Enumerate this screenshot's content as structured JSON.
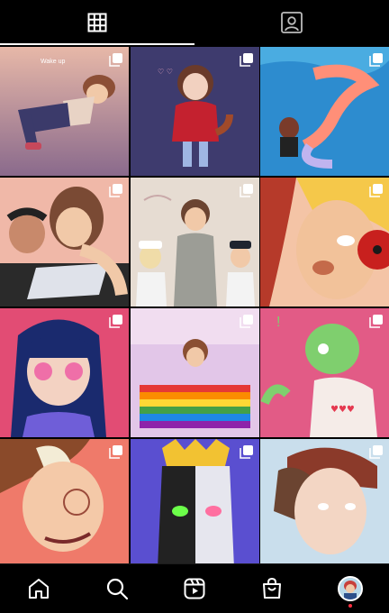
{
  "tabs": [
    {
      "name": "grid",
      "icon": "grid-icon",
      "active": true
    },
    {
      "name": "tagged",
      "icon": "tagged-person-icon",
      "active": false
    }
  ],
  "posts": [
    {
      "id": "post-1",
      "watermark": "Wake up",
      "multi": true
    },
    {
      "id": "post-2",
      "watermark": "",
      "multi": true
    },
    {
      "id": "post-3",
      "watermark": "",
      "multi": true
    },
    {
      "id": "post-4",
      "watermark": "",
      "multi": true
    },
    {
      "id": "post-5",
      "watermark": "",
      "multi": true
    },
    {
      "id": "post-6",
      "watermark": "",
      "multi": true
    },
    {
      "id": "post-7",
      "watermark": "",
      "multi": true
    },
    {
      "id": "post-8",
      "watermark": "",
      "multi": true
    },
    {
      "id": "post-9",
      "watermark": "",
      "multi": true
    },
    {
      "id": "post-10",
      "watermark": "",
      "multi": true
    },
    {
      "id": "post-11",
      "watermark": "",
      "multi": true
    },
    {
      "id": "post-12",
      "watermark": "",
      "multi": true
    }
  ],
  "bottom_nav": [
    {
      "name": "home",
      "icon": "home-icon"
    },
    {
      "name": "search",
      "icon": "search-icon"
    },
    {
      "name": "reels",
      "icon": "reels-icon"
    },
    {
      "name": "shop",
      "icon": "shop-bag-icon"
    },
    {
      "name": "profile",
      "icon": "profile-avatar",
      "has_notification": true
    }
  ],
  "colors": {
    "background": "#000000",
    "icon": "#ffffff",
    "notification": "#ff3040"
  }
}
